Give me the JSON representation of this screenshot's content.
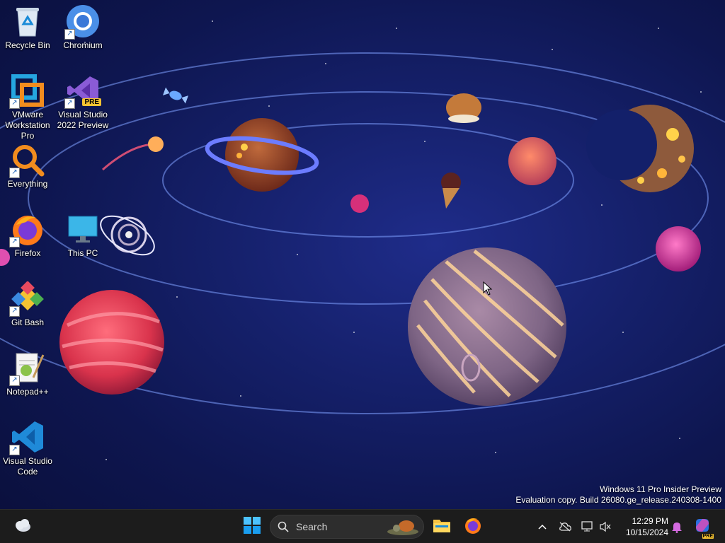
{
  "desktop": {
    "icons": [
      {
        "label": "Recycle Bin"
      },
      {
        "label": "Chromium"
      },
      {
        "label": "VMware Workstation Pro"
      },
      {
        "label": "Visual Studio 2022 Preview",
        "badge": "PRE"
      },
      {
        "label": "Everything"
      },
      {
        "label": "Firefox"
      },
      {
        "label": "This PC"
      },
      {
        "label": "Git Bash"
      },
      {
        "label": "Notepad++"
      },
      {
        "label": "Visual Studio Code"
      }
    ]
  },
  "watermark": {
    "line1": "Windows 11 Pro Insider Preview",
    "line2": "Evaluation copy. Build 26080.ge_release.240308-1400"
  },
  "taskbar": {
    "search_label": "Search",
    "clock_time": "12:29 PM",
    "clock_date": "10/15/2024",
    "copilot_badge": "PRE",
    "apps": [
      "start-icon",
      "file-explorer-icon",
      "firefox-icon"
    ]
  },
  "colors": {
    "taskbar_bg": "#1c1c1c",
    "wallpaper_bg": "#15206a",
    "accent": "#0078d4"
  }
}
